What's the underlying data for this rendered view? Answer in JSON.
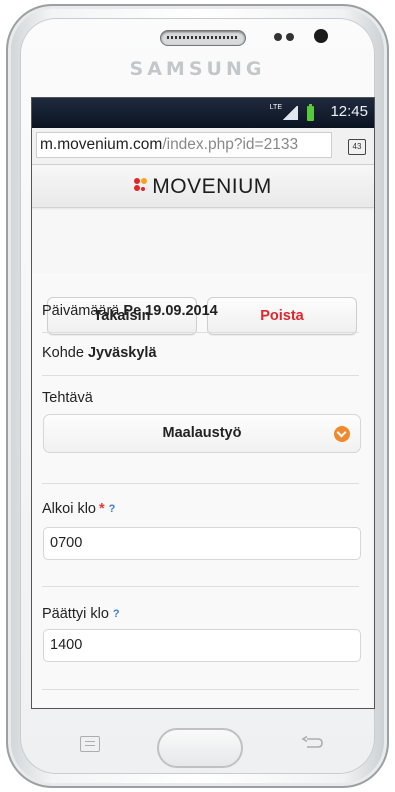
{
  "device": {
    "brand": "SAMSUNG"
  },
  "statusbar": {
    "time": "12:45",
    "network": "LTE"
  },
  "browser": {
    "url_host": "m.movenium.com",
    "url_path": "/index.php?id=2133",
    "tab_count": "43"
  },
  "app": {
    "logo_text": "MOVENIUM"
  },
  "actions": {
    "back_label": "Takaisin",
    "delete_label": "Poista"
  },
  "details": {
    "date_label": "Päivämäärä",
    "date_value": "Pe 19.09.2014",
    "target_label": "Kohde",
    "target_value": "Jyväskylä"
  },
  "task": {
    "label": "Tehtävä",
    "selected": "Maalaustyö"
  },
  "start": {
    "label": "Alkoi klo",
    "required_mark": "*",
    "help": "?",
    "value": "0700"
  },
  "end": {
    "label": "Päättyi klo",
    "help": "?",
    "value": "1400"
  },
  "colors": {
    "delete": "#e0252b",
    "accent": "#ef8a2e",
    "help": "#3e7bd6"
  }
}
